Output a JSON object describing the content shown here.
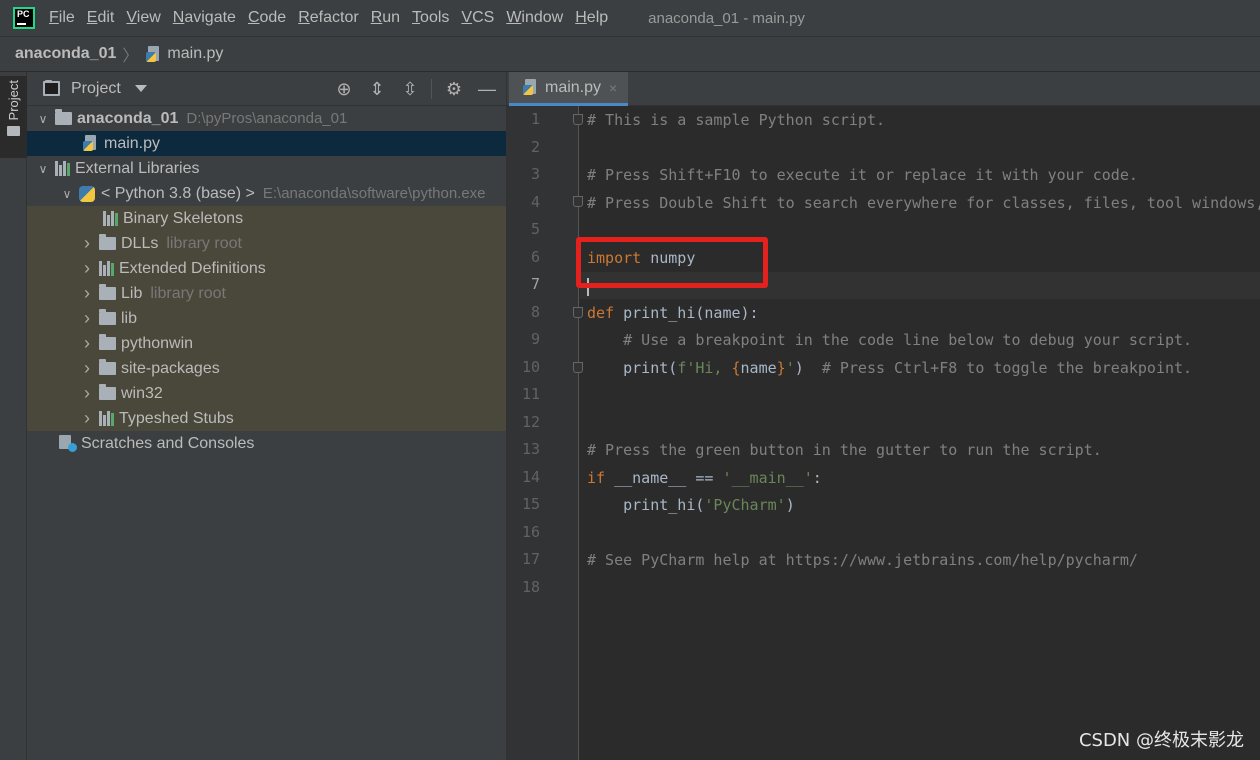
{
  "menubar": {
    "items": [
      {
        "label": "File",
        "u": "F",
        "rest": "ile"
      },
      {
        "label": "Edit",
        "u": "E",
        "rest": "dit"
      },
      {
        "label": "View",
        "u": "V",
        "rest": "iew"
      },
      {
        "label": "Navigate",
        "u": "N",
        "rest": "avigate"
      },
      {
        "label": "Code",
        "u": "C",
        "rest": "ode"
      },
      {
        "label": "Refactor",
        "u": "R",
        "rest": "efactor"
      },
      {
        "label": "Run",
        "u": "R",
        "rest": "un"
      },
      {
        "label": "Tools",
        "u": "T",
        "rest": "ools"
      },
      {
        "label": "VCS",
        "u": "V",
        "rest": "CS"
      },
      {
        "label": "Window",
        "u": "W",
        "rest": "indow"
      },
      {
        "label": "Help",
        "u": "H",
        "rest": "elp"
      }
    ],
    "window_title": "anaconda_01 - main.py",
    "logo_text": "PC"
  },
  "breadcrumb": {
    "project": "anaconda_01",
    "separator": "〉",
    "file": "main.py"
  },
  "stripe": {
    "project_label": "Project"
  },
  "project_panel": {
    "title": "Project",
    "tools": [
      "locate-icon",
      "expand-all-icon",
      "collapse-all-icon",
      "gear-icon",
      "hide-icon"
    ],
    "tree": {
      "root": {
        "label": "anaconda_01",
        "path": "D:\\pyPros\\anaconda_01"
      },
      "main_file": "main.py",
      "external_libraries": "External Libraries",
      "python_sdk": {
        "label": "< Python 3.8 (base) >",
        "path": "E:\\anaconda\\software\\python.exe"
      },
      "children": [
        {
          "label": "Binary Skeletons",
          "hint": ""
        },
        {
          "label": "DLLs",
          "hint": "library root"
        },
        {
          "label": "Extended Definitions",
          "hint": ""
        },
        {
          "label": "Lib",
          "hint": "library root"
        },
        {
          "label": "lib",
          "hint": ""
        },
        {
          "label": "pythonwin",
          "hint": ""
        },
        {
          "label": "site-packages",
          "hint": ""
        },
        {
          "label": "win32",
          "hint": ""
        },
        {
          "label": "Typeshed Stubs",
          "hint": ""
        }
      ],
      "scratches": "Scratches and Consoles"
    }
  },
  "editor": {
    "tab_label": "main.py",
    "tab_close": "×",
    "current_line": 7,
    "line_numbers": [
      "1",
      "2",
      "3",
      "4",
      "5",
      "6",
      "7",
      "8",
      "9",
      "10",
      "11",
      "12",
      "13",
      "14",
      "15",
      "16",
      "17",
      "18"
    ],
    "lines": {
      "l1": "# This is a sample Python script.",
      "l3": "# Press Shift+F10 to execute it or replace it with your code.",
      "l4": "# Press Double Shift to search everywhere for classes, files, tool windows, actions, and settings.",
      "l6_kw": "import",
      "l6_rest": " numpy",
      "l8_kw": "def",
      "l8_rest": " print_hi(name):",
      "l9": "    # Use a breakpoint in the code line below to debug your script.",
      "l10_a": "    print(",
      "l10_str1": "f'Hi, ",
      "l10_brace1": "{",
      "l10_var": "name",
      "l10_brace2": "}",
      "l10_str2": "'",
      "l10_b": ")  ",
      "l10_cm": "# Press Ctrl+F8 to toggle the breakpoint.",
      "l13": "# Press the green button in the gutter to run the script.",
      "l14_kw": "if",
      "l14_a": " __name__ == ",
      "l14_str": "'__main__'",
      "l14_b": ":",
      "l15_a": "    print_hi(",
      "l15_str": "'PyCharm'",
      "l15_b": ")",
      "l17": "# See PyCharm help at https://www.jetbrains.com/help/pycharm/"
    }
  },
  "watermark": "CSDN @终极末影龙",
  "colors": {
    "keyword": "#cc7832",
    "string": "#6a8759",
    "comment": "#808080",
    "highlight_box": "#e5211d"
  }
}
